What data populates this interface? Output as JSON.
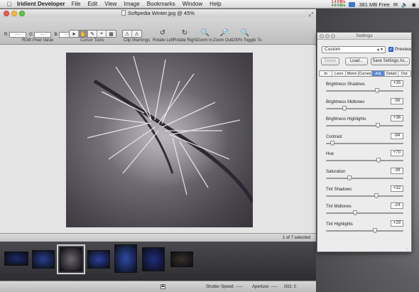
{
  "menubar": {
    "app_name": "Iridient Developer",
    "items": [
      "File",
      "Edit",
      "View",
      "Image",
      "Bookmarks",
      "Window",
      "Help"
    ],
    "memory": "381 MB Free",
    "net_up": "1.4 KB/s",
    "net_down": "4.9 KB/s"
  },
  "window": {
    "title": "Softpedia Winter.jpg @ 45%"
  },
  "toolbar": {
    "r_label": "R:",
    "g_label": "G:",
    "b_label": "B:",
    "r_value": "-----",
    "g_value": "-----",
    "b_value": "-----",
    "rgb_caption": "RGB Pixel Value",
    "cursor_caption": "Cursor Tools",
    "clip_caption": "Clip Warnings",
    "rotate_left": "Rotate Left",
    "rotate_right": "Rotate Right",
    "zoom_in": "Zoom In",
    "zoom_out": "Zoom Out",
    "toggle": "100% Toggle To"
  },
  "status": {
    "selection": "1 of 7 selected",
    "shutter": "Shutter Speed: -----",
    "aperture": "Aperture: -----",
    "iso": "ISO: 0"
  },
  "filmstrip": {
    "selected_index": 2,
    "thumb_colors": [
      "#1d2a66",
      "#27408f",
      "#6e666f",
      "#2b3f9a",
      "#2d4aa8",
      "#1f2d7a",
      "#3a3128"
    ]
  },
  "settings": {
    "title": "Settings",
    "preset": "Custom",
    "preview_label": "Preview",
    "preview_checked": true,
    "delete_label": "Delete",
    "load_label": "Load...",
    "save_label": "Save Settings As...",
    "tabs": [
      "In",
      "Lens",
      "Mono",
      "Curves",
      "Adj",
      "Detail",
      "Out"
    ],
    "active_tab": "Adj",
    "sliders": [
      {
        "label": "Brightness Shadows",
        "value": "+35",
        "fraction": 0.66
      },
      {
        "label": "Brightness Midtones",
        "value": "-56",
        "fraction": 0.24
      },
      {
        "label": "Brightness Highlights",
        "value": "+36",
        "fraction": 0.67
      },
      {
        "label": "Contrast",
        "value": "-84",
        "fraction": 0.08
      },
      {
        "label": "Hue",
        "value": "+70",
        "fraction": 0.68
      },
      {
        "label": "Saturation",
        "value": "-39",
        "fraction": 0.3
      },
      {
        "label": "Tint Shadows",
        "value": "+32",
        "fraction": 0.65
      },
      {
        "label": "Tint Midtones",
        "value": "-24",
        "fraction": 0.38
      },
      {
        "label": "Tint Highlights",
        "value": "+29",
        "fraction": 0.63
      }
    ]
  }
}
